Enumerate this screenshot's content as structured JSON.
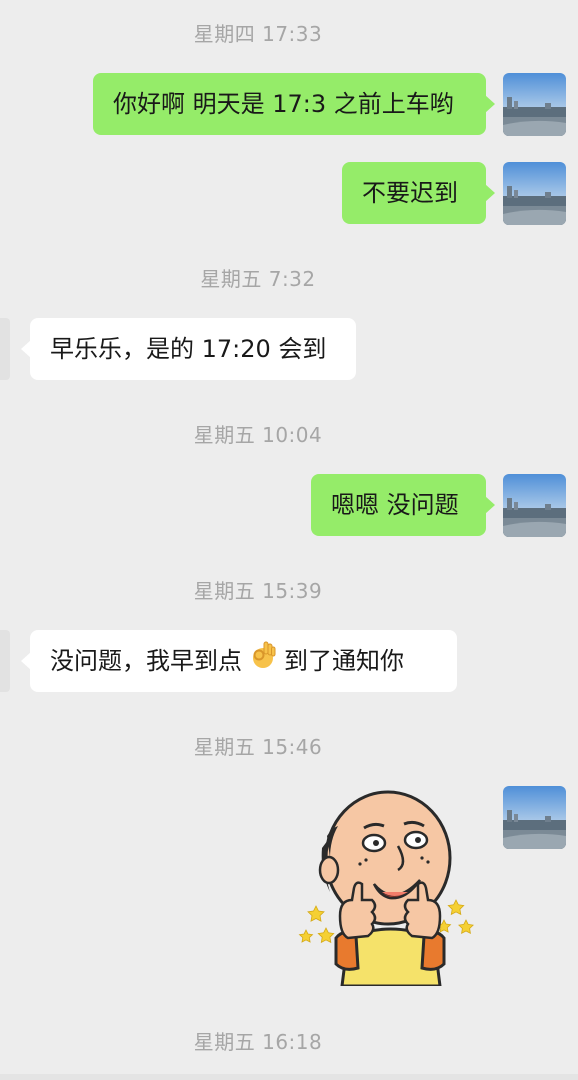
{
  "chat": {
    "timestamps": [
      "星期四 17:33",
      "星期五 7:32",
      "星期五 10:04",
      "星期五 15:39",
      "星期五 15:46",
      "星期五 16:18"
    ],
    "messages": {
      "m1": "你好啊 明天是 17:3 之前上车哟",
      "m2": "不要迟到",
      "m3": "早乐乐，是的 17:20 会到",
      "m4": "嗯嗯 没问题",
      "m5_before": "没问题，我早到点",
      "m5_after": "到了通知你"
    },
    "icons": {
      "avatar": "avatar-city-skyline-icon",
      "ok_emoji": "ok-hand-icon",
      "sticker": "thumbs-up-sticker"
    },
    "colors": {
      "sent_bubble": "#95ec69",
      "received_bubble": "#ffffff",
      "background": "#ededed",
      "timestamp": "#a6a6a6"
    }
  }
}
